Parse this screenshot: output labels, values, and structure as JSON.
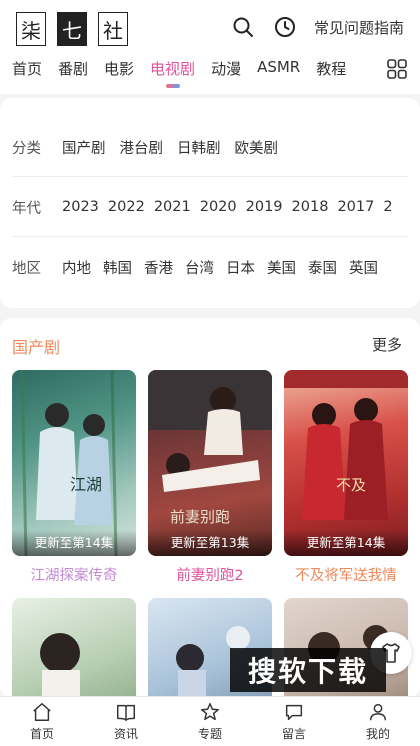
{
  "logo": {
    "chars": [
      "柒",
      "七",
      "社"
    ]
  },
  "header": {
    "faq_label": "常见问题指南"
  },
  "tabs": [
    "首页",
    "番剧",
    "电影",
    "电视剧",
    "动漫",
    "ASMR",
    "教程"
  ],
  "active_tab": "电视剧",
  "filters": {
    "category": {
      "label": "分类",
      "options": [
        "国产剧",
        "港台剧",
        "日韩剧",
        "欧美剧"
      ]
    },
    "year": {
      "label": "年代",
      "options": [
        "2023",
        "2022",
        "2021",
        "2020",
        "2019",
        "2018",
        "2017",
        "2"
      ]
    },
    "region": {
      "label": "地区",
      "options": [
        "内地",
        "韩国",
        "香港",
        "台湾",
        "日本",
        "美国",
        "泰国",
        "英国"
      ]
    }
  },
  "section": {
    "title": "国产剧",
    "more": "更多",
    "cards": [
      {
        "title": "江湖探案传奇",
        "update": "更新至第14集",
        "title_color": "#c58ad8"
      },
      {
        "title": "前妻别跑2",
        "update": "更新至第13集",
        "title_color": "#e0539b"
      },
      {
        "title": "不及将军送我情",
        "update": "更新至第14集",
        "title_color": "#f08a5b"
      }
    ]
  },
  "watermark": "搜软下载",
  "bottom_nav": [
    "首页",
    "资讯",
    "专题",
    "留言",
    "我的"
  ],
  "icons": {
    "search": "search-icon",
    "history": "clock-icon",
    "grid": "grid-icon",
    "nav": [
      "home-icon",
      "book-icon",
      "star-icon",
      "chat-icon",
      "person-icon"
    ]
  },
  "colors": {
    "accent": "#e0539b",
    "section_title": "#f08a5b"
  }
}
